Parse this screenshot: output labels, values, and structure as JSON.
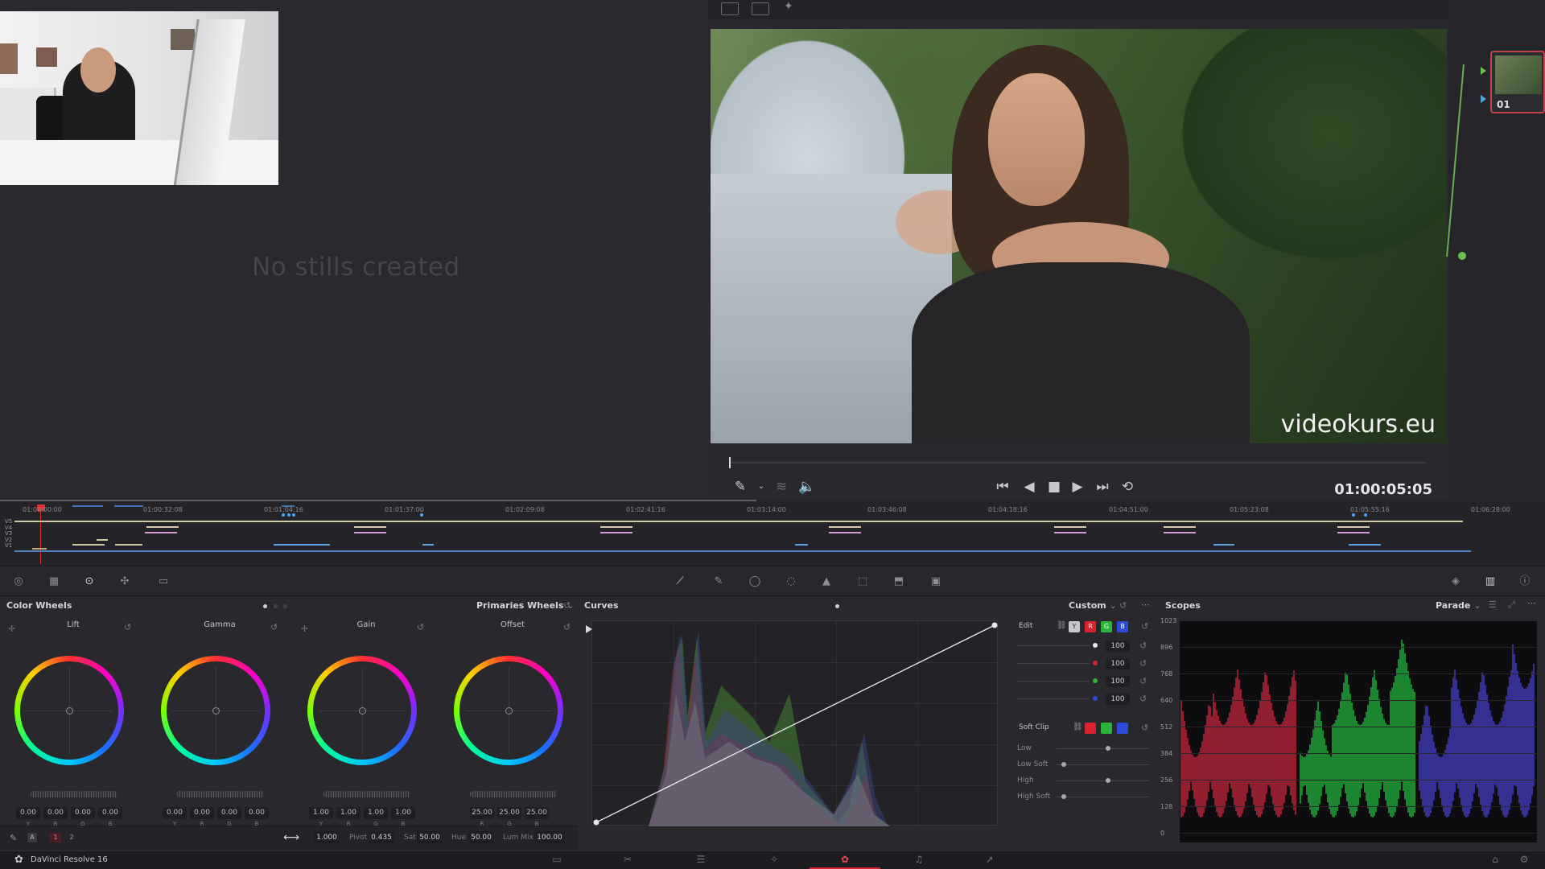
{
  "gallery": {
    "empty_text": "No stills created"
  },
  "viewer": {
    "watermark": "videokurs.eu",
    "timecode": "01:00:05:05"
  },
  "nodes": {
    "node_label": "01"
  },
  "timeline": {
    "timecodes": [
      "01:00:00:00",
      "01:00:32:08",
      "01:01:04:16",
      "01:01:37:00",
      "01:02:09:08",
      "01:02:41:16",
      "01:03:14:00",
      "01:03:46:08",
      "01:04:18:16",
      "01:04:51:00",
      "01:05:23:08",
      "01:05:55:16",
      "01:06:28:00"
    ],
    "tracks": [
      "V5",
      "V4",
      "V3",
      "V2",
      "V1"
    ]
  },
  "color_wheels": {
    "title": "Color Wheels",
    "mode": "Primaries Wheels",
    "wheels": [
      {
        "name": "Lift",
        "values": [
          "0.00",
          "0.00",
          "0.00",
          "0.00"
        ],
        "channels": [
          "Y",
          "R",
          "G",
          "B"
        ]
      },
      {
        "name": "Gamma",
        "values": [
          "0.00",
          "0.00",
          "0.00",
          "0.00"
        ],
        "channels": [
          "Y",
          "R",
          "G",
          "B"
        ]
      },
      {
        "name": "Gain",
        "values": [
          "1.00",
          "1.00",
          "1.00",
          "1.00"
        ],
        "channels": [
          "Y",
          "R",
          "G",
          "B"
        ]
      },
      {
        "name": "Offset",
        "values": [
          "25.00",
          "25.00",
          "25.00"
        ],
        "channels": [
          "R",
          "G",
          "B"
        ]
      }
    ],
    "footer": {
      "mode_a": "A",
      "page_1": "1",
      "page_2": "2",
      "contrast_value": "1.000",
      "pivot_label": "Pivot",
      "pivot_value": "0.435",
      "sat_label": "Sat",
      "sat_value": "50.00",
      "hue_label": "Hue",
      "hue_value": "50.00",
      "lummix_label": "Lum Mix",
      "lummix_value": "100.00"
    }
  },
  "curves": {
    "title": "Curves",
    "preset": "Custom"
  },
  "edit": {
    "title": "Edit",
    "channel_buttons": [
      "Y",
      "R",
      "G",
      "B"
    ],
    "values": [
      "100",
      "100",
      "100",
      "100"
    ],
    "soft_clip_title": "Soft Clip",
    "soft_clip_rows": [
      "Low",
      "Low Soft",
      "High",
      "High Soft"
    ]
  },
  "scopes": {
    "title": "Scopes",
    "mode": "Parade",
    "scale": [
      "1023",
      "896",
      "768",
      "640",
      "512",
      "384",
      "256",
      "128",
      "0"
    ],
    "colors": {
      "red": "#ff2f4a",
      "green": "#29e84a",
      "blue": "#5b4dff"
    }
  },
  "status": {
    "app_name": "DaVinci Resolve 16"
  }
}
